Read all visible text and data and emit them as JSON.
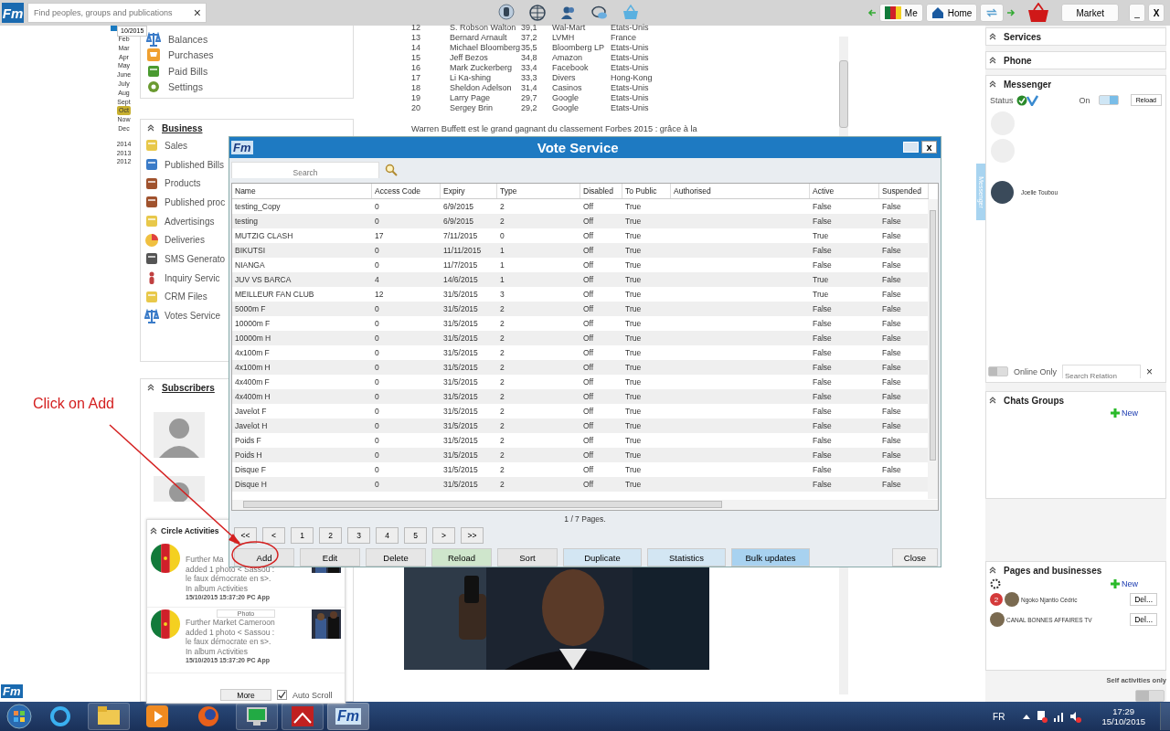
{
  "top_bar": {
    "logo": "Fm",
    "search": {
      "placeholder": "Find peoples, groups and publications"
    },
    "clear": "×",
    "me": "Me",
    "home": "Home",
    "market": "Market",
    "minimize": "_",
    "close": "X"
  },
  "calendar": {
    "tooltip": "10/2015",
    "months": [
      {
        "label": "Feb",
        "selected": false
      },
      {
        "label": "Mar",
        "selected": false
      },
      {
        "label": "Apr",
        "selected": false
      },
      {
        "label": "May",
        "selected": false
      },
      {
        "label": "June",
        "selected": false
      },
      {
        "label": "July",
        "selected": false
      },
      {
        "label": "Aug",
        "selected": false
      },
      {
        "label": "Sept",
        "selected": false
      },
      {
        "label": "Oct",
        "selected": true
      },
      {
        "label": "Now",
        "selected": false
      },
      {
        "label": "Dec",
        "selected": false
      }
    ],
    "years": [
      "2014",
      "2013",
      "2012"
    ]
  },
  "menu_card": {
    "items": [
      "Balances",
      "Purchases",
      "Paid Bills",
      "Settings"
    ]
  },
  "business": {
    "title": "Business",
    "items": [
      "Sales",
      "Published Bills",
      "Products",
      "Published proc",
      "Advertisings",
      "Deliveries",
      "SMS Generato",
      "Inquiry Servic",
      "CRM Files",
      "Votes Service"
    ]
  },
  "subscribers": {
    "title": "Subscribers"
  },
  "article": {
    "rows": [
      {
        "rank": "12",
        "name": "S. Robson Walton",
        "worth": "39,1",
        "company": "Wal-Mart",
        "country": "Etats-Unis"
      },
      {
        "rank": "13",
        "name": "Bernard Arnault",
        "worth": "37,2",
        "company": "LVMH",
        "country": "France"
      },
      {
        "rank": "14",
        "name": "Michael Bloomberg",
        "worth": "35,5",
        "company": "Bloomberg LP",
        "country": "Etats-Unis"
      },
      {
        "rank": "15",
        "name": "Jeff Bezos",
        "worth": "34,8",
        "company": "Amazon",
        "country": "Etats-Unis"
      },
      {
        "rank": "16",
        "name": "Mark Zuckerberg",
        "worth": "33,4",
        "company": "Facebook",
        "country": "Etats-Unis"
      },
      {
        "rank": "17",
        "name": "Li Ka-shing",
        "worth": "33,3",
        "company": "Divers",
        "country": "Hong-Kong"
      },
      {
        "rank": "18",
        "name": "Sheldon Adelson",
        "worth": "31,4",
        "company": "Casinos",
        "country": "Etats-Unis"
      },
      {
        "rank": "19",
        "name": "Larry Page",
        "worth": "29,7",
        "company": "Google",
        "country": "Etats-Unis"
      },
      {
        "rank": "20",
        "name": "Sergey Brin",
        "worth": "29,2",
        "company": "Google",
        "country": "Etats-Unis"
      }
    ],
    "text": "Warren Buffett est le grand gagnant du classement Forbes 2015 : grâce à la"
  },
  "right_panel": {
    "services": "Services",
    "phone": "Phone",
    "messenger": {
      "title": "Messenger",
      "status": "Status",
      "on_label": "On",
      "on": true,
      "reload": "Reload",
      "contacts": [
        "Joelle Toubou"
      ],
      "online_only": {
        "label": "Online Only",
        "on": false
      },
      "search": {
        "placeholder": "Search Relation"
      },
      "clear": "×",
      "side_tab": "Messenger"
    },
    "chats_groups": {
      "title": "Chats Groups",
      "new": "New"
    },
    "pages": {
      "title": "Pages and businesses",
      "new": "New",
      "items": [
        {
          "name": "Ngoko Njantio Cédric",
          "badge": "2",
          "delete": "Del..."
        },
        {
          "name": "CANAL BONNES AFFAIRES TV",
          "delete": "Del..."
        }
      ]
    },
    "self_activities": {
      "label": "Self activities only",
      "on": false
    }
  },
  "dialog": {
    "logo": "Fm",
    "title": "Vote Service",
    "close": "x",
    "search": {
      "placeholder": "Search"
    },
    "columns": [
      "Name",
      "Access Code",
      "Expiry",
      "Type",
      "Disabled",
      "To Public",
      "Authorised",
      "Active",
      "Suspended"
    ],
    "rows": [
      [
        "testing_Copy",
        "0",
        "6/9/2015",
        "2",
        "Off",
        "True",
        "",
        "False",
        "False"
      ],
      [
        "testing",
        "0",
        "6/9/2015",
        "2",
        "Off",
        "True",
        "",
        "False",
        "False"
      ],
      [
        "MUTZIG CLASH",
        "17",
        "7/11/2015",
        "0",
        "Off",
        "True",
        "",
        "True",
        "False"
      ],
      [
        "BIKUTSI",
        "0",
        "11/11/2015",
        "1",
        "Off",
        "True",
        "",
        "False",
        "False"
      ],
      [
        "NIANGA",
        "0",
        "11/7/2015",
        "1",
        "Off",
        "True",
        "",
        "False",
        "False"
      ],
      [
        "JUV VS BARCA",
        "4",
        "14/6/2015",
        "1",
        "Off",
        "True",
        "",
        "True",
        "False"
      ],
      [
        "MEILLEUR FAN CLUB",
        "12",
        "31/5/2015",
        "3",
        "Off",
        "True",
        "",
        "True",
        "False"
      ],
      [
        "5000m F",
        "0",
        "31/5/2015",
        "2",
        "Off",
        "True",
        "",
        "False",
        "False"
      ],
      [
        "10000m F",
        "0",
        "31/5/2015",
        "2",
        "Off",
        "True",
        "",
        "False",
        "False"
      ],
      [
        "10000m H",
        "0",
        "31/5/2015",
        "2",
        "Off",
        "True",
        "",
        "False",
        "False"
      ],
      [
        "4x100m F",
        "0",
        "31/5/2015",
        "2",
        "Off",
        "True",
        "",
        "False",
        "False"
      ],
      [
        "4x100m H",
        "0",
        "31/5/2015",
        "2",
        "Off",
        "True",
        "",
        "False",
        "False"
      ],
      [
        "4x400m F",
        "0",
        "31/5/2015",
        "2",
        "Off",
        "True",
        "",
        "False",
        "False"
      ],
      [
        "4x400m H",
        "0",
        "31/5/2015",
        "2",
        "Off",
        "True",
        "",
        "False",
        "False"
      ],
      [
        "Javelot F",
        "0",
        "31/5/2015",
        "2",
        "Off",
        "True",
        "",
        "False",
        "False"
      ],
      [
        "Javelot H",
        "0",
        "31/5/2015",
        "2",
        "Off",
        "True",
        "",
        "False",
        "False"
      ],
      [
        "Poids F",
        "0",
        "31/5/2015",
        "2",
        "Off",
        "True",
        "",
        "False",
        "False"
      ],
      [
        "Poids H",
        "0",
        "31/5/2015",
        "2",
        "Off",
        "True",
        "",
        "False",
        "False"
      ],
      [
        "Disque F",
        "0",
        "31/5/2015",
        "2",
        "Off",
        "True",
        "",
        "False",
        "False"
      ],
      [
        "Disque H",
        "0",
        "31/5/2015",
        "2",
        "Off",
        "True",
        "",
        "False",
        "False"
      ]
    ],
    "page_info": "1 / 7 Pages.",
    "pager": [
      "<<",
      "<",
      "1",
      "2",
      "3",
      "4",
      "5",
      ">",
      ">>"
    ],
    "buttons": [
      {
        "label": "Add",
        "color": "#e6e6e6"
      },
      {
        "label": "Edit",
        "color": "#e6e6e6"
      },
      {
        "label": "Delete",
        "color": "#e6e6e6"
      },
      {
        "label": "Reload",
        "color": "#cfe6cc"
      },
      {
        "label": "Sort",
        "color": "#e6e6e6"
      },
      {
        "label": "Duplicate",
        "color": "#d3e6f3"
      },
      {
        "label": "Statistics",
        "color": "#d3e6f3"
      },
      {
        "label": "Bulk updates",
        "color": "#a8d2f0"
      }
    ],
    "close_button": "Close"
  },
  "circle_activities": {
    "title": "Circle Activities",
    "items": [
      {
        "lines": [
          "Further Ma",
          "added 1 photo < Sassou :",
          "le faux démocrate en s>.",
          "In album Activities"
        ],
        "time": "15/10/2015 15:37:20 PC App"
      },
      {
        "badge": "Photo",
        "lines": [
          "Further Market Cameroon",
          "added 1 photo < Sassou :",
          "le faux démocrate en s>.",
          "In album Activities"
        ],
        "time": "15/10/2015 15:37:20 PC App"
      }
    ],
    "more": "More",
    "auto_scroll": {
      "label": "Auto Scroll",
      "checked": true
    }
  },
  "annotation": {
    "text": "Click on Add"
  },
  "bottom_logo": "Fm",
  "taskbar": {
    "app_logo": "Fm",
    "language": "FR",
    "time": "17:29",
    "date": "15/10/2015"
  }
}
